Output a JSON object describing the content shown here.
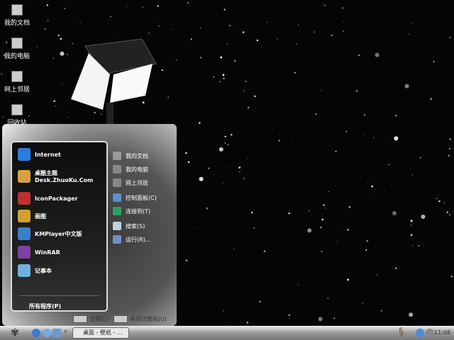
{
  "desktop": {
    "icons": [
      {
        "label": "我的文档",
        "icon": "my-documents-icon"
      },
      {
        "label": "我的电脑",
        "icon": "my-computer-icon"
      },
      {
        "label": "网上邻居",
        "icon": "network-places-icon"
      },
      {
        "label": "回收站",
        "icon": "recycle-bin-icon"
      }
    ]
  },
  "start_menu": {
    "pinned": [
      {
        "label": "Internet",
        "icon": "internet-explorer-icon",
        "color": "#2a7de1"
      },
      {
        "label": "桌酷主题",
        "sub": "Desk.ZhuoKu.Com",
        "icon": "zhuoku-icon",
        "color": "#d8a040"
      },
      {
        "label": "IconPackager",
        "icon": "iconpackager-icon",
        "color": "#c03030"
      },
      {
        "label": "画图",
        "icon": "paint-icon",
        "color": "#d0a030"
      },
      {
        "label": "KMPlayer中文版",
        "icon": "kmplayer-icon",
        "color": "#3a80c8"
      },
      {
        "label": "WinRAR",
        "icon": "winrar-icon",
        "color": "#8040a0"
      },
      {
        "label": "记事本",
        "icon": "notepad-icon",
        "color": "#70b0e0"
      }
    ],
    "all_programs": "所有程序(P)",
    "right": [
      {
        "label": "我的文档",
        "icon": "my-documents-icon",
        "color": "#999"
      },
      {
        "label": "我的电脑",
        "icon": "my-computer-icon",
        "color": "#888"
      },
      {
        "label": "网上邻居",
        "icon": "network-places-icon",
        "color": "#888"
      },
      {
        "label": "控制面板(C)",
        "icon": "control-panel-icon",
        "color": "#5a90d0"
      },
      {
        "label": "连接到(T)",
        "icon": "connect-to-icon",
        "color": "#30a060"
      },
      {
        "label": "搜索(S)",
        "icon": "search-icon",
        "color": "#c0d0e0"
      },
      {
        "label": "运行(R)...",
        "icon": "run-icon",
        "color": "#7090c0"
      }
    ],
    "logoff": "注销(L)",
    "shutdown": "关闭计算机(U)"
  },
  "taskbar": {
    "task_label": "桌面 - 壁纸 - ...",
    "clock": "11:08",
    "overflow": "»"
  }
}
